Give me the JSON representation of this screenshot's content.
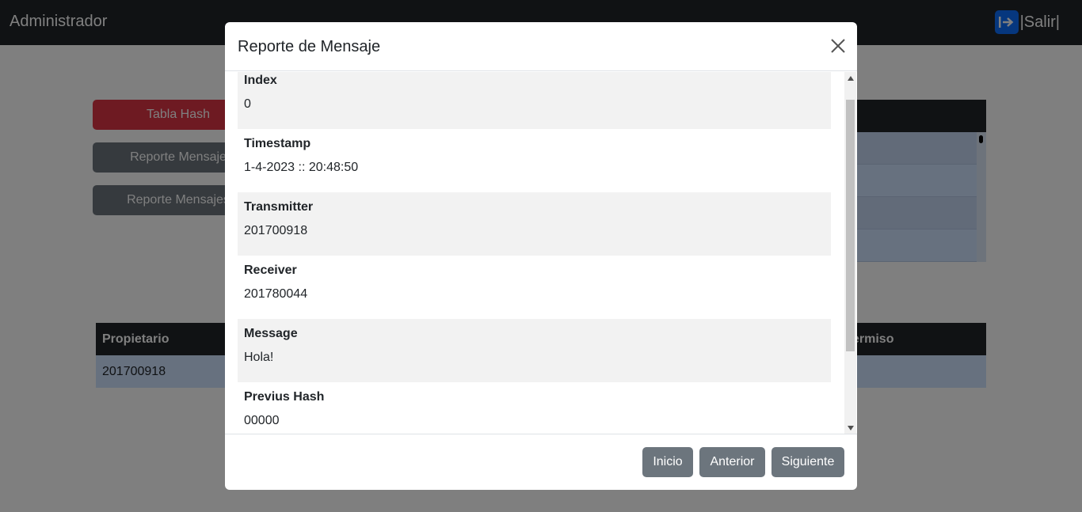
{
  "navbar": {
    "brand": "Administrador",
    "logout_label": "|Salir|",
    "logout_icon": "sign-out-icon"
  },
  "sidebar": {
    "buttons": [
      {
        "label": "Tabla Hash",
        "color": "#dc3545"
      },
      {
        "label": "Reporte Mensaje",
        "color": "#6c757d"
      },
      {
        "label": "Reporte Mensajes",
        "color": "#6c757d"
      }
    ]
  },
  "permissions_table": {
    "headers": [
      "Propietario",
      "ermiso"
    ],
    "rows": [
      [
        "201700918"
      ]
    ]
  },
  "modal": {
    "title": "Reporte de Mensaje",
    "close_icon": "close-icon",
    "fields": [
      {
        "label": "Index",
        "value": "0"
      },
      {
        "label": "Timestamp",
        "value": "1-4-2023 :: 20:48:50"
      },
      {
        "label": "Transmitter",
        "value": "201700918"
      },
      {
        "label": "Receiver",
        "value": "201780044"
      },
      {
        "label": "Message",
        "value": "Hola!"
      },
      {
        "label": "Previus Hash",
        "value": "00000"
      }
    ],
    "footer_buttons": {
      "first": "Inicio",
      "previous": "Anterior",
      "next": "Siguiente"
    }
  }
}
